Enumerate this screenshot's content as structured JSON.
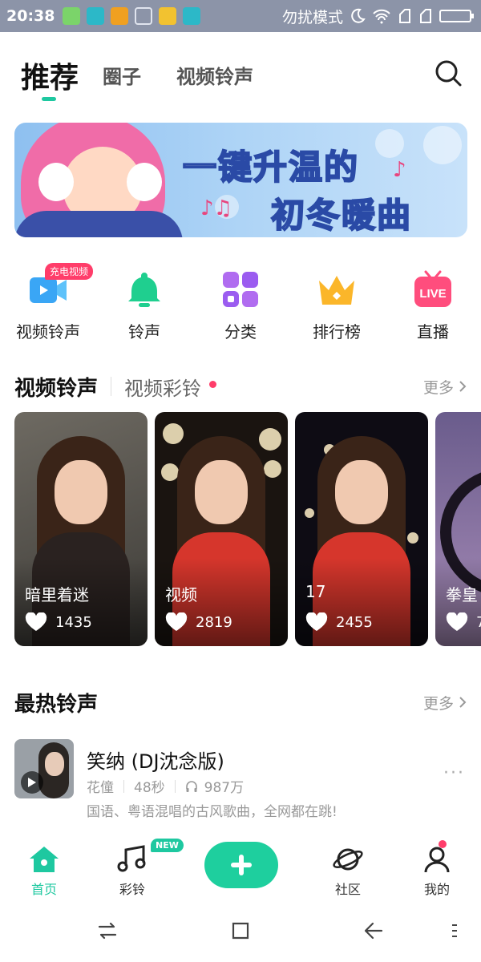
{
  "status_bar": {
    "time": "20:38",
    "mode_text": "勿扰模式",
    "icons": [
      "app-icon-green",
      "app-icon-teal",
      "warning-icon",
      "cleaner-icon",
      "folder-icon",
      "usb-icon",
      "moon-icon",
      "wifi-icon",
      "signal-icon",
      "signal-icon",
      "battery-icon"
    ]
  },
  "top_tabs": {
    "active": "推荐",
    "others": [
      "圈子",
      "视频铃声"
    ]
  },
  "banner": {
    "line1_prefix": "一键",
    "line1_highlight": "升温",
    "line1_suffix": "的",
    "line2": "初冬暖曲"
  },
  "categories": [
    {
      "label": "视频铃声",
      "icon": "video-ringtone-icon",
      "badge": "充电视频"
    },
    {
      "label": "铃声",
      "icon": "bell-icon"
    },
    {
      "label": "分类",
      "icon": "grid-icon"
    },
    {
      "label": "排行榜",
      "icon": "crown-icon"
    },
    {
      "label": "直播",
      "icon": "live-tv-icon",
      "icon_text": "LIVE"
    }
  ],
  "video_section": {
    "title": "视频铃声",
    "sub_tab": "视频彩铃",
    "more": "更多"
  },
  "video_cards": [
    {
      "title": "暗里着迷",
      "likes": "1435"
    },
    {
      "title": "视频",
      "likes": "2819"
    },
    {
      "title": "17",
      "likes": "2455"
    },
    {
      "title": "拳皇",
      "likes": "7"
    }
  ],
  "hot_section": {
    "title": "最热铃声",
    "more": "更多"
  },
  "hot_song": {
    "name": "笑纳 (DJ沈念版)",
    "artist": "花僮",
    "duration": "48秒",
    "plays": "987万",
    "description": "国语、粤语混唱的古风歌曲，全网都在跳!"
  },
  "bottom_nav": {
    "home": "首页",
    "ringback": "彩铃",
    "new_badge": "NEW",
    "community": "社区",
    "mine": "我的"
  },
  "colors": {
    "accent": "#1ec8a0",
    "badge": "#ff3d6a",
    "status_bar": "#8c94a8"
  }
}
